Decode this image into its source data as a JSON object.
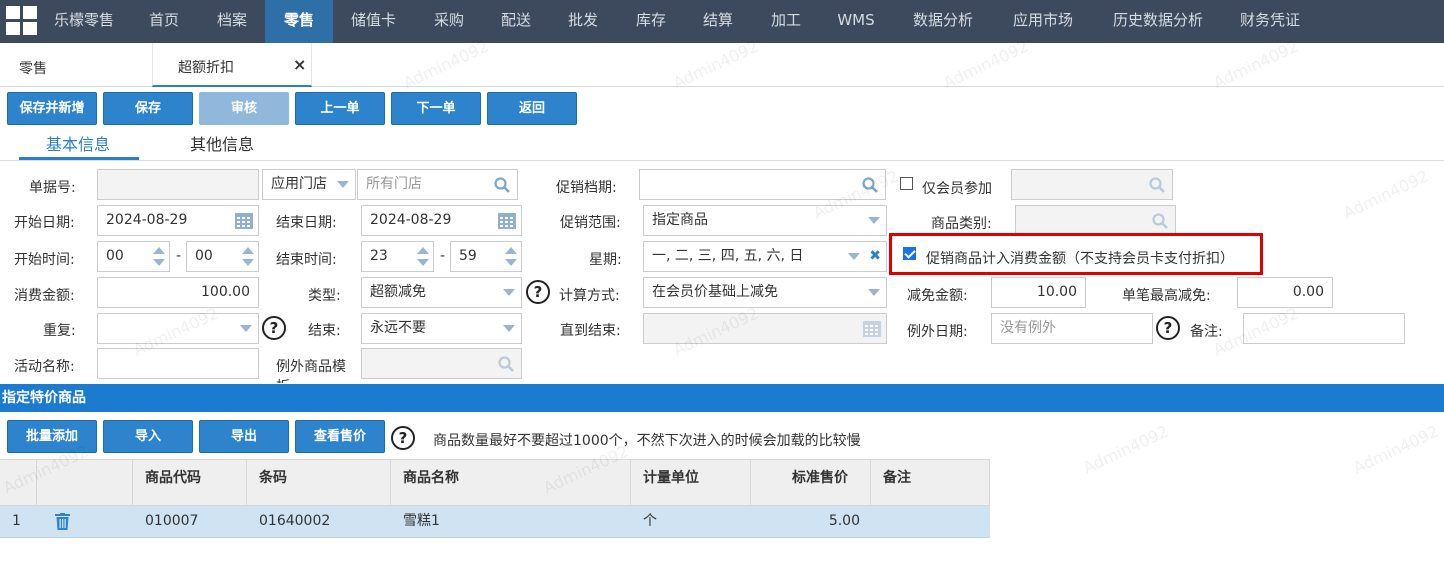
{
  "topnav": {
    "brand": "乐檬零售",
    "items": [
      "首页",
      "档案",
      "零售",
      "储值卡",
      "采购",
      "配送",
      "批发",
      "库存",
      "结算",
      "加工",
      "WMS",
      "数据分析",
      "应用市场",
      "历史数据分析",
      "财务凭证"
    ],
    "active_index": 2
  },
  "tabs": {
    "home": "零售",
    "current": "超额折扣",
    "close": "×"
  },
  "toolbar": {
    "save_new": "保存并新增",
    "save": "保存",
    "audit": "审核",
    "prev": "上一单",
    "next": "下一单",
    "back": "返回"
  },
  "subtabs": {
    "basic": "基本信息",
    "other": "其他信息"
  },
  "form": {
    "doc_no_label": "单据号:",
    "doc_no": "",
    "store_select": "应用门店",
    "store_placeholder": "所有门店",
    "promo_period_label": "促销档期:",
    "member_only_label": "仅会员参加",
    "start_date_label": "开始日期:",
    "start_date": "2024-08-29",
    "end_date_label": "结束日期:",
    "end_date": "2024-08-29",
    "promo_scope_label": "促销范围:",
    "promo_scope": "指定商品",
    "category_label": "商品类别:",
    "start_time_label": "开始时间:",
    "start_hour": "00",
    "start_min": "00",
    "end_time_label": "结束时间:",
    "end_hour": "23",
    "end_min": "59",
    "dash": "-",
    "weekday_label": "星期:",
    "weekday": "一, 二, 三, 四, 五, 六, 日",
    "count_in_amount_label": "促销商品计入消费金额（不支持会员卡支付折扣）",
    "amount_label": "消费金额:",
    "amount": "100.00",
    "type_label": "类型:",
    "type": "超额减免",
    "calc_label": "计算方式:",
    "calc": "在会员价基础上减免",
    "reduce_label": "减免金额:",
    "reduce": "10.00",
    "max_reduce_label": "单笔最高减免:",
    "max_reduce": "0.00",
    "repeat_label": "重复:",
    "end_label": "结束:",
    "end": "永远不要",
    "until_label": "直到结束:",
    "exception_date_label": "例外日期:",
    "exception_placeholder": "没有例外",
    "note_label": "备注:",
    "activity_label": "活动名称:",
    "exception_goods_label": "例外商品模板:"
  },
  "section": {
    "title": "指定特价商品",
    "batch_add": "批量添加",
    "import": "导入",
    "export": "导出",
    "view_price": "查看售价",
    "hint": "商品数量最好不要超过1000个，不然下次进入的时候会加载的比较慢"
  },
  "grid": {
    "headers": [
      "商品代码",
      "条码",
      "商品名称",
      "计量单位",
      "标准售价",
      "备注"
    ],
    "rows": [
      {
        "index": "1",
        "code": "010007",
        "barcode": "01640002",
        "name": "雪糕1",
        "unit": "个",
        "price": "5.00",
        "note": ""
      }
    ]
  },
  "watermark": "Admin4092",
  "colors": {
    "accent": "#2d84cc",
    "nav": "#3d4a5d",
    "highlight": "#e00000"
  }
}
